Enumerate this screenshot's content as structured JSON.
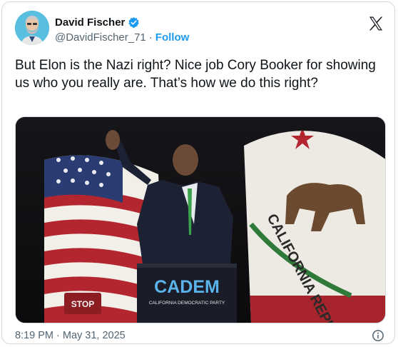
{
  "author": {
    "display_name": "David Fischer",
    "handle": "@DavidFischer_71",
    "separator": "·",
    "follow_label": "Follow",
    "verified_color": "#1d9bf0"
  },
  "tweet": {
    "text": "But Elon is the Nazi right? Nice job Cory Booker for showing us who you really are. That’s how we do this right?",
    "timestamp": "8:19 PM · May 31, 2025"
  },
  "media": {
    "podium_logo": "CADEM",
    "podium_subtitle": "CALIFORNIA DEMOCRATIC PARTY",
    "flag_text": "CALIFORNIA REPUBLIC",
    "sign_text": "STOP"
  },
  "icons": {
    "platform": "x-logo-icon",
    "verified": "verified-badge-icon",
    "info": "info-icon"
  },
  "colors": {
    "accent": "#1d9bf0",
    "text_primary": "#0f1419",
    "text_secondary": "#536471",
    "border": "#cfd9de"
  }
}
